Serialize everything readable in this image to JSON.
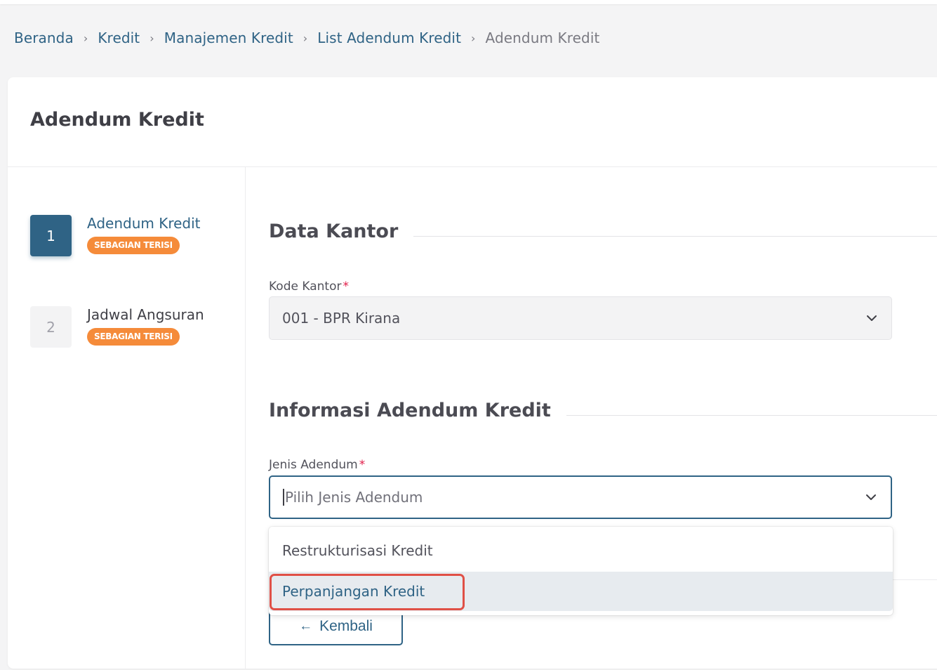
{
  "breadcrumb": {
    "items": [
      "Beranda",
      "Kredit",
      "Manajemen Kredit",
      "List Adendum Kredit"
    ],
    "current": "Adendum Kredit",
    "separator": "›"
  },
  "page_title": "Adendum Kredit",
  "steps": [
    {
      "number": "1",
      "label": "Adendum Kredit",
      "badge": "SEBAGIAN TERISI",
      "active": true
    },
    {
      "number": "2",
      "label": "Jadwal Angsuran",
      "badge": "SEBAGIAN TERISI",
      "active": false
    }
  ],
  "sections": {
    "data_kantor": {
      "title": "Data Kantor",
      "kode_kantor_label": "Kode Kantor",
      "required_mark": "*",
      "kode_kantor_value": "001 - BPR Kirana"
    },
    "informasi": {
      "title": "Informasi Adendum Kredit",
      "jenis_label": "Jenis Adendum",
      "required_mark": "*",
      "jenis_placeholder": "Pilih Jenis Adendum",
      "options": [
        "Restrukturisasi Kredit",
        "Perpanjangan Kredit"
      ]
    }
  },
  "buttons": {
    "back_arrow": "←",
    "back_label": "Kembali"
  },
  "colors": {
    "primary": "#2f6385",
    "badge": "#f58b3a",
    "highlight": "#e05046",
    "required": "#e11d48"
  },
  "icons": {
    "chevron": "chevron-down-icon",
    "back": "arrow-left-icon"
  }
}
